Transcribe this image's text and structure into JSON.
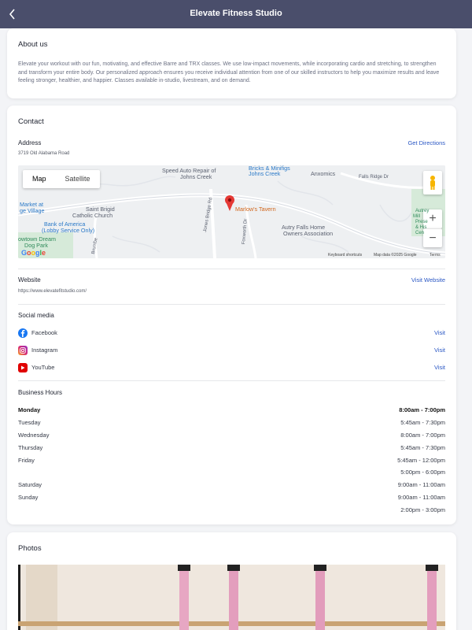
{
  "header": {
    "title": "Elevate Fitness Studio"
  },
  "about": {
    "title": "About us",
    "text": "Elevate your workout with our fun, motivating, and effective Barre and TRX classes. We use low-impact movements, while incorporating cardio and stretching, to strengthen and transform your entire body. Our personalized approach ensures you receive individual attention from one of our skilled instructors to help you maximize results and leave feeling stronger, healthier, and happier. Classes available in-studio, livestream, and on demand."
  },
  "contact": {
    "title": "Contact",
    "address_label": "Address",
    "address": "3719 Old Alabama Road",
    "directions_label": "Get Directions",
    "map": {
      "map_tab": "Map",
      "satellite_tab": "Satellite",
      "labels": {
        "speed_auto": "Speed Auto Repair of",
        "speed_auto2": "Johns Creek",
        "bricks": "Bricks & Minifigs",
        "bricks2": "Johns Creek",
        "anxomics": "Anxomics",
        "falls_ridge": "Falls Ridge Dr",
        "market": "Market at",
        "village": "ge Village",
        "saint_brigid": "Saint Brigid",
        "saint_brigid2": "Catholic Church",
        "marlows": "Marlow's Tavern",
        "jones_bridge": "Jones Bridge Rd",
        "foxworth": "Foxworth Dr",
        "bank": "Bank of America",
        "bank2": "(Lobby Service Only)",
        "autry_falls": "Autry Falls Home",
        "autry_falls2": "Owners Association",
        "dream_dog": "owtown Dream",
        "dream_dog2": "Dog Park",
        "brumbe": "Brumbe",
        "autrey_mill": "Autrey",
        "autrey_mill2": "Mill",
        "autrey_mill3": "Prese",
        "autrey_mill4": "& His",
        "autrey_mill5": "Cen",
        "google": "Google",
        "shortcuts": "Keyboard shortcuts",
        "mapdata": "Map data ©2025 Google",
        "terms": "Terms",
        "zoom_in": "+",
        "zoom_out": "−"
      }
    },
    "website_label": "Website",
    "website_url": "https://www.elevatefitstudio.com/",
    "visit_website_label": "Visit Website",
    "social_label": "Social media",
    "social": [
      {
        "name": "Facebook",
        "visit": "Visit",
        "color": "#1877f2"
      },
      {
        "name": "Instagram",
        "visit": "Visit",
        "color": "#d62976"
      },
      {
        "name": "YouTube",
        "visit": "Visit",
        "color": "#e00000"
      }
    ],
    "hours_label": "Business Hours",
    "hours": [
      {
        "day": "Monday",
        "times": [
          "8:00am - 7:00pm"
        ]
      },
      {
        "day": "Tuesday",
        "times": [
          "5:45am - 7:30pm"
        ]
      },
      {
        "day": "Wednesday",
        "times": [
          "8:00am - 7:00pm"
        ]
      },
      {
        "day": "Thursday",
        "times": [
          "5:45am - 7:30pm"
        ]
      },
      {
        "day": "Friday",
        "times": [
          "5:45am - 12:00pm",
          "5:00pm - 6:00pm"
        ]
      },
      {
        "day": "Saturday",
        "times": [
          "9:00am - 11:00am"
        ]
      },
      {
        "day": "Sunday",
        "times": [
          "9:00am - 11:00am",
          "2:00pm - 3:00pm"
        ]
      }
    ]
  },
  "photos": {
    "title": "Photos"
  },
  "colors": {
    "header_bg": "#4a4e6b",
    "link": "#2a57c4",
    "pin": "#e53935"
  },
  "icons": {
    "back": "chevron-left-icon",
    "facebook": "facebook-icon",
    "instagram": "instagram-icon",
    "youtube": "youtube-icon",
    "pin": "map-pin-icon",
    "pegman": "street-view-icon"
  }
}
